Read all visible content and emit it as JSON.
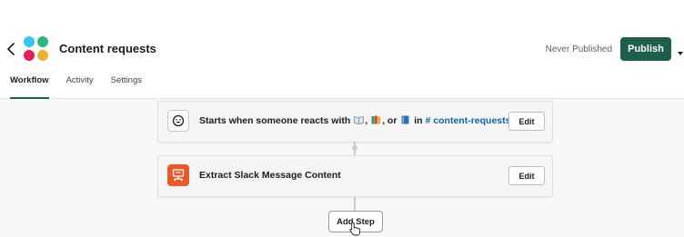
{
  "header": {
    "title": "Content requests",
    "publish_status": "Never Published",
    "publish_label": "Publish",
    "accent_color": "#1f5d4d"
  },
  "tabs": [
    {
      "label": "Workflow",
      "active": true
    },
    {
      "label": "Activity",
      "active": false
    },
    {
      "label": "Settings",
      "active": false
    }
  ],
  "steps": [
    {
      "icon": "reaction-emoji-icon",
      "text_before": "Starts when someone reacts with",
      "text_separator_1": ",",
      "text_separator_2": ", or",
      "text_in": "in",
      "channel": "# content-requests",
      "edit_label": "Edit"
    },
    {
      "icon": "extract-message-icon",
      "text": "Extract Slack Message Content",
      "edit_label": "Edit"
    }
  ],
  "add_step_label": "Add Step",
  "colors": {
    "channel_link": "#1264a3",
    "extract_icon_bg": "#e8592a",
    "logo_blue": "#36c5f0",
    "logo_green": "#2eb67d",
    "logo_red": "#e01e5a",
    "logo_yellow": "#ecb22e"
  }
}
